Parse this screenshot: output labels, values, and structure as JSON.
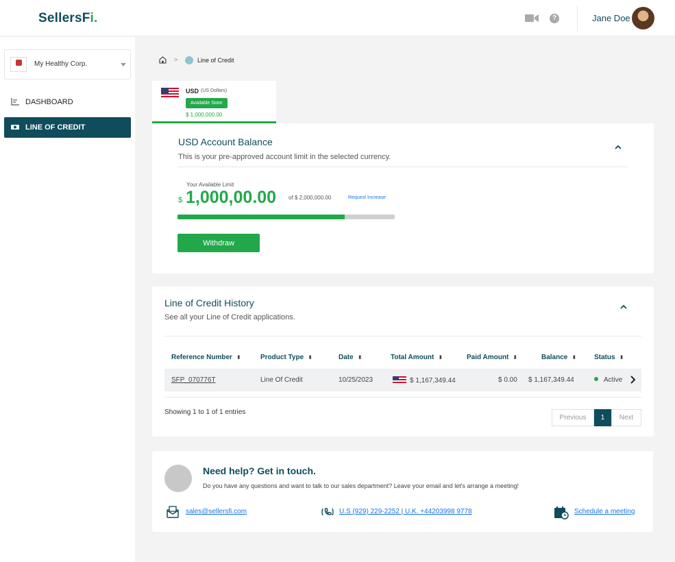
{
  "header": {
    "logo_main": "SellersF",
    "logo_accent": "i.",
    "help_glyph": "?",
    "user_name": "Jane Doe"
  },
  "sidebar": {
    "company": "My Healthy Corp.",
    "items": [
      {
        "label": "DASHBOARD",
        "icon": "dashboard-icon",
        "active": false
      },
      {
        "label": "LINE OF CREDIT",
        "icon": "cash-icon",
        "active": true
      }
    ]
  },
  "breadcrumb": {
    "separator": ">",
    "current": "Line of Credit"
  },
  "currency_tab": {
    "code": "USD",
    "name": "(US Dollars)",
    "badge": "Available Soon",
    "amount": "$ 1,000,000.00"
  },
  "balance": {
    "title": "USD Account Balance",
    "subtitle": "This is your pre-approved account limit in the selected currency.",
    "available_label": "Your Available Limit",
    "currency_symbol": "$",
    "available_amount": "1,000,00.00",
    "of_total": "of $ 2,000,000.00",
    "request_link": "Request Increase",
    "progress_fraction": 0.77,
    "withdraw_label": "Withdraw"
  },
  "history": {
    "title": "Line of Credit History",
    "subtitle": "See all your Line of Credit applications.",
    "columns": [
      "Reference Number",
      "Product Type",
      "Date",
      "Total Amount",
      "Paid Amount",
      "Balance",
      "Status"
    ],
    "sort_glyph": "⬍",
    "rows": [
      {
        "reference": "SFP_070776T",
        "product": "Line Of Credit",
        "date": "10/25/2023",
        "total": "$ 1,167,349.44",
        "paid": "$ 0.00",
        "balance": "$ 1,167,349.44",
        "status": "Active"
      }
    ],
    "showing": "Showing 1 to 1 of 1 entries",
    "pager": {
      "prev": "Previous",
      "page": "1",
      "next": "Next"
    }
  },
  "help": {
    "title": "Need help? Get in touch.",
    "subtitle": "Do you have any questions and want to talk to our sales department? Leave your email and let's arrange a meeting!",
    "email": "sales@sellersfi.com",
    "phone": "U.S (929) 229-2252 | U.K. +44203998 9778",
    "schedule": "Schedule a meeting"
  },
  "colors": {
    "brand_teal": "#0f4c5c",
    "accent_green": "#22a84a",
    "link_blue": "#1a73e8"
  }
}
